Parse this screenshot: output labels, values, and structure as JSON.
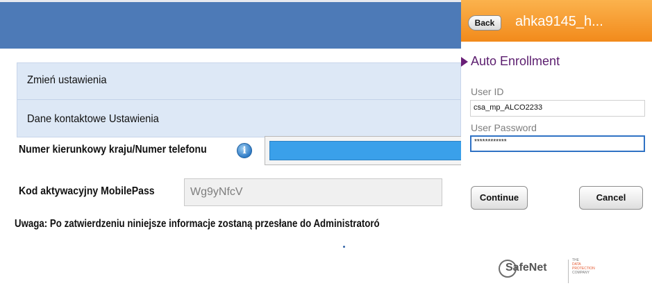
{
  "web": {
    "section_change_settings": "Zmień ustawienia",
    "section_contact_settings": "Dane kontaktowe Ustawienia",
    "phone_label": "Numer kierunkowy kraju/Numer telefonu",
    "phone_value": "",
    "activation_label": "Kod aktywacyjny MobilePass",
    "activation_code": "Wg9yNfcV",
    "note": "Uwaga: Po zatwierdzeniu niniejsze informacje zostaną przesłane do Administratoró",
    "info_icon": "info-icon",
    "colors": {
      "header": "#4d7ab7",
      "section_bg": "#dde8f6",
      "phone_input": "#3aa0ea"
    }
  },
  "mobile": {
    "back_label": "Back",
    "title": "ahka9145_h...",
    "section_title": "Auto Enrollment",
    "user_id_label": "User ID",
    "user_id_value": "csa_mp_ALCO2233",
    "password_label": "User Password",
    "password_value": "************",
    "continue_label": "Continue",
    "cancel_label": "Cancel",
    "colors": {
      "header": "#f28a1b",
      "section": "#5b1d6e"
    }
  },
  "logo": {
    "name": "SafeNet",
    "tagline_1": "THE",
    "tagline_2": "DATA",
    "tagline_3": "PROTECTION",
    "tagline_4": "COMPANY"
  }
}
